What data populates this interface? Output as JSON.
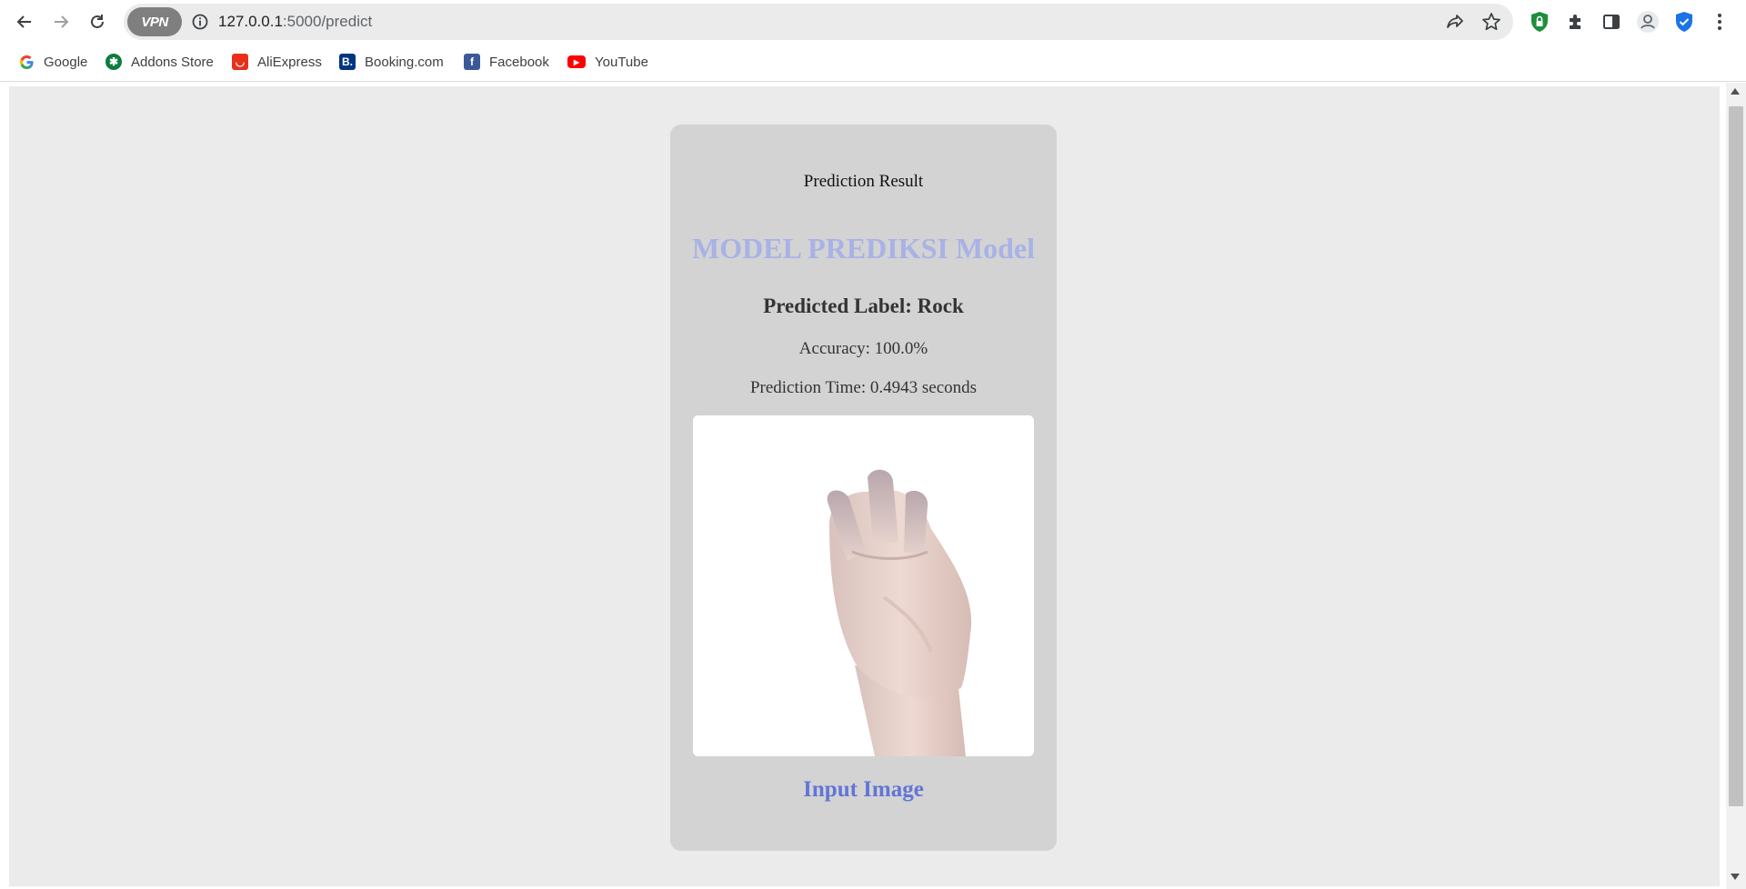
{
  "browser": {
    "vpn_label": "VPN",
    "url_host": "127.0.0.1",
    "url_path": ":5000/predict"
  },
  "bookmarks": [
    {
      "label": "Google",
      "icon": "google-icon"
    },
    {
      "label": "Addons Store",
      "icon": "addons-store-icon"
    },
    {
      "label": "AliExpress",
      "icon": "aliexpress-icon"
    },
    {
      "label": "Booking.com",
      "icon": "booking-icon"
    },
    {
      "label": "Facebook",
      "icon": "facebook-icon"
    },
    {
      "label": "YouTube",
      "icon": "youtube-icon"
    }
  ],
  "card": {
    "title": "Prediction Result",
    "heading": "MODEL PREDIKSI Model",
    "predicted_label": "Predicted Label: Rock",
    "accuracy": "Accuracy: 100.0%",
    "prediction_time": "Prediction Time: 0.4943 seconds",
    "image_caption": "Input Image"
  },
  "colors": {
    "page_bg": "#ebebeb",
    "card_bg": "#d3d3d3",
    "heading": "#a9b2e6",
    "caption": "#6275d6"
  }
}
